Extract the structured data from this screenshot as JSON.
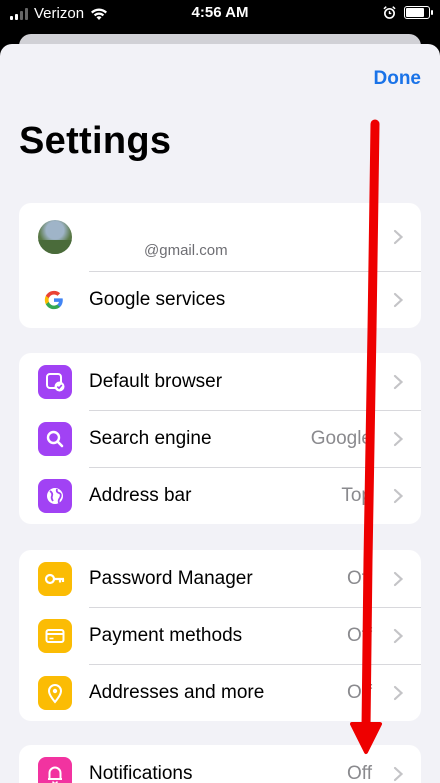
{
  "status_bar": {
    "carrier": "Verizon",
    "time": "4:56 AM"
  },
  "header": {
    "done_label": "Done",
    "title": "Settings"
  },
  "account": {
    "email": "@gmail.com"
  },
  "groups": [
    {
      "items": [
        {
          "label": "Google services",
          "icon": "google-g-icon"
        }
      ]
    },
    {
      "items": [
        {
          "label": "Default browser",
          "icon": "default-browser-icon",
          "value": ""
        },
        {
          "label": "Search engine",
          "icon": "search-icon",
          "value": "Google"
        },
        {
          "label": "Address bar",
          "icon": "globe-icon",
          "value": "Top"
        }
      ]
    },
    {
      "items": [
        {
          "label": "Password Manager",
          "icon": "key-icon",
          "value": "Off"
        },
        {
          "label": "Payment methods",
          "icon": "credit-card-icon",
          "value": "Off"
        },
        {
          "label": "Addresses and more",
          "icon": "location-pin-icon",
          "value": "Off"
        }
      ]
    },
    {
      "items": [
        {
          "label": "Notifications",
          "icon": "bell-icon",
          "value": "Off"
        }
      ]
    }
  ],
  "colors": {
    "accent": "#1a73e8",
    "purple": "#a142f4",
    "yellow": "#fbbc04",
    "pink": "#f233a0",
    "annotation_arrow": "#ee0000"
  }
}
